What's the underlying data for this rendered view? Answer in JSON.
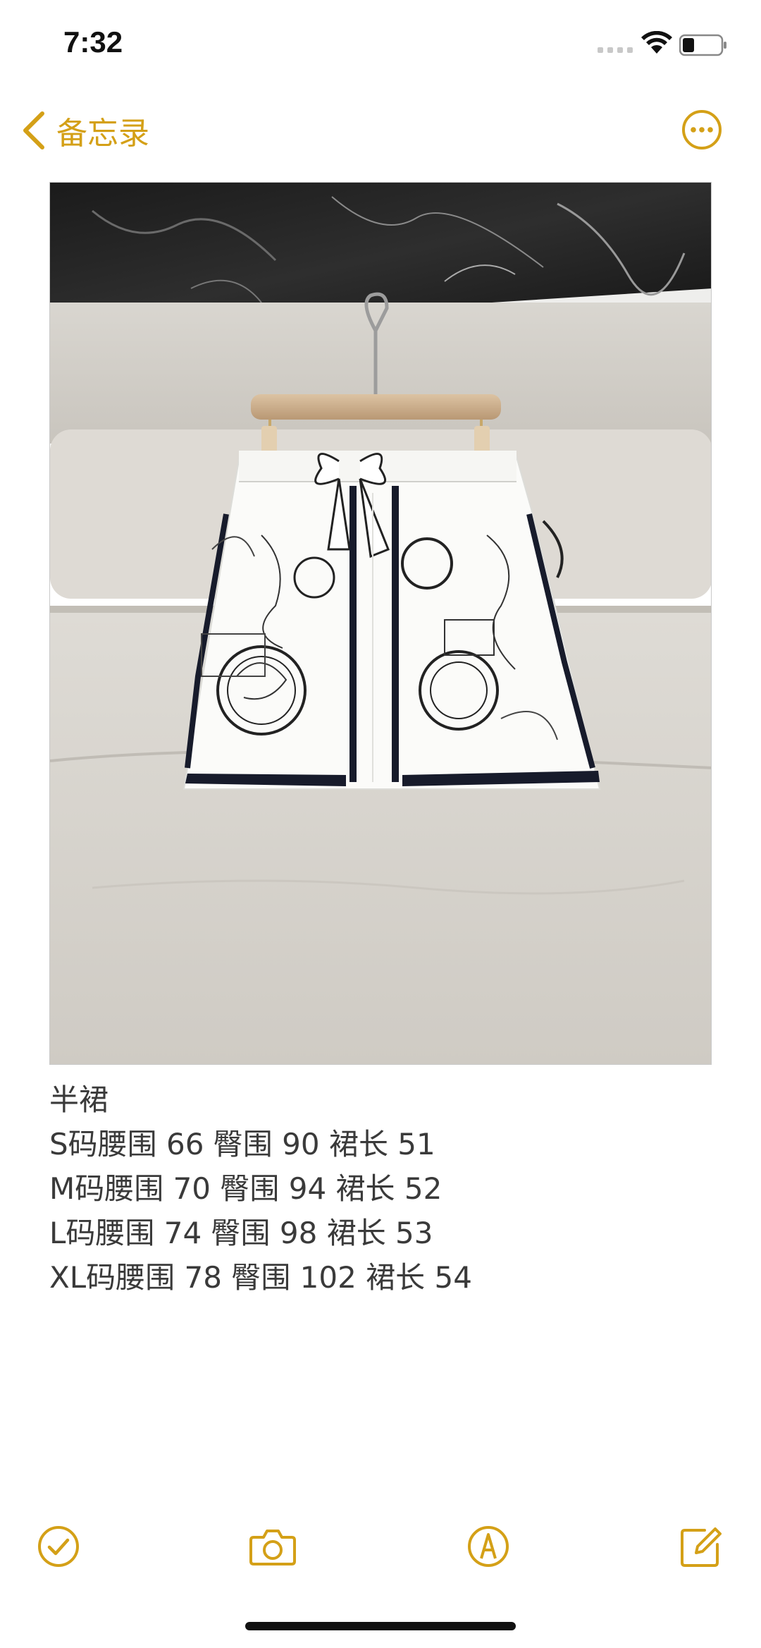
{
  "status_bar": {
    "time": "7:32"
  },
  "nav": {
    "back_label": "备忘录",
    "back_icon": "chevron-left-icon",
    "more_icon": "ellipsis-circle-icon",
    "accent_color": "#d4a017"
  },
  "note": {
    "photo_subject": "white silk skirt with black sketch print on hanger",
    "lines": [
      "半裙",
      "S码腰围 66 臀围 90 裙长 51",
      "M码腰围 70 臀围 94 裙长 52",
      "L码腰围 74 臀围 98 裙长 53",
      "XL码腰围 78 臀围 102 裙长 54"
    ]
  },
  "toolbar": {
    "checklist_icon": "checkmark-circle-icon",
    "camera_icon": "camera-icon",
    "markup_icon": "pen-circle-icon",
    "compose_icon": "compose-icon"
  }
}
